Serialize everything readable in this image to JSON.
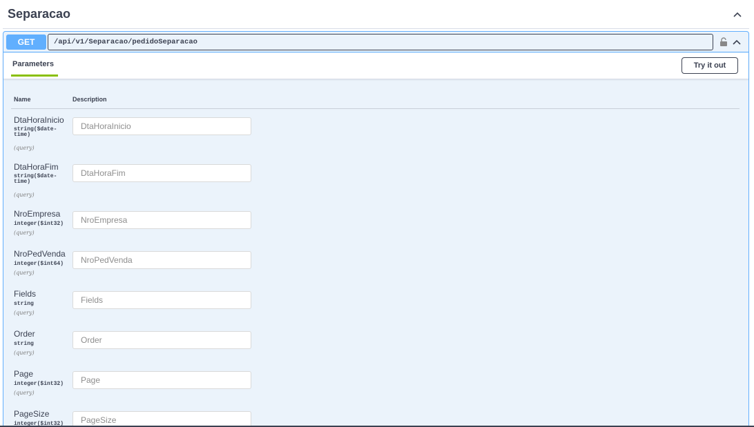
{
  "tag": {
    "title": "Separacao"
  },
  "operation": {
    "method": "GET",
    "path": "/api/v1/Separacao/pedidoSeparacao",
    "method_color": "#61affe"
  },
  "parameters_section": {
    "tab_label": "Parameters",
    "try_button": "Try it out",
    "col_name": "Name",
    "col_description": "Description"
  },
  "params": [
    {
      "name": "DtaHoraInicio",
      "type_line1": "string($date-",
      "type_line2": "time)",
      "in": "(query)",
      "placeholder": "DtaHoraInicio"
    },
    {
      "name": "DtaHoraFim",
      "type_line1": "string($date-",
      "type_line2": "time)",
      "in": "(query)",
      "placeholder": "DtaHoraFim"
    },
    {
      "name": "NroEmpresa",
      "type_line1": "integer($int32)",
      "in": "(query)",
      "placeholder": "NroEmpresa"
    },
    {
      "name": "NroPedVenda",
      "type_line1": "integer($int64)",
      "in": "(query)",
      "placeholder": "NroPedVenda"
    },
    {
      "name": "Fields",
      "type_line1": "string",
      "in": "(query)",
      "placeholder": "Fields"
    },
    {
      "name": "Order",
      "type_line1": "string",
      "in": "(query)",
      "placeholder": "Order"
    },
    {
      "name": "Page",
      "type_line1": "integer($int32)",
      "in": "(query)",
      "placeholder": "Page"
    },
    {
      "name": "PageSize",
      "type_line1": "integer($int32)",
      "placeholder": "PageSize"
    }
  ],
  "icons": {
    "tag_toggle": "chevron-up-icon",
    "lock": "lock-icon",
    "collapse": "chevron-up-icon"
  }
}
